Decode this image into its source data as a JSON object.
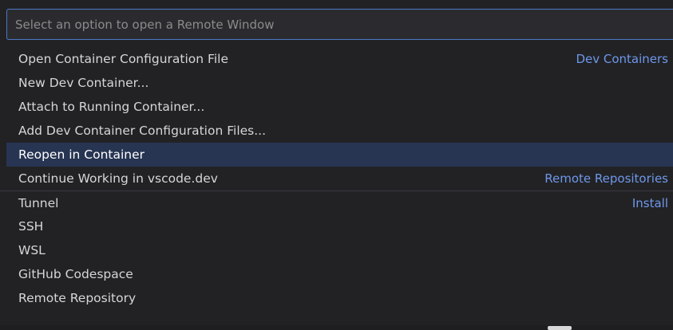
{
  "quick_pick": {
    "placeholder": "Select an option to open a Remote Window",
    "items": [
      {
        "label": "Open Container Configuration File",
        "group": "Dev Containers"
      },
      {
        "label": "New Dev Container...",
        "group": ""
      },
      {
        "label": "Attach to Running Container...",
        "group": ""
      },
      {
        "label": "Add Dev Container Configuration Files...",
        "group": ""
      },
      {
        "label": "Reopen in Container",
        "group": "",
        "selected": true
      },
      {
        "label": "Continue Working in vscode.dev",
        "group": "Remote Repositories"
      },
      {
        "label": "Tunnel",
        "group": "Install"
      },
      {
        "label": "SSH",
        "group": ""
      },
      {
        "label": "WSL",
        "group": ""
      },
      {
        "label": "GitHub Codespace",
        "group": ""
      },
      {
        "label": "Remote Repository",
        "group": ""
      }
    ]
  },
  "colors": {
    "background": "#222225",
    "accent_border": "#4a79c4",
    "selected_row": "#273552",
    "group_label": "#6e98ea"
  }
}
